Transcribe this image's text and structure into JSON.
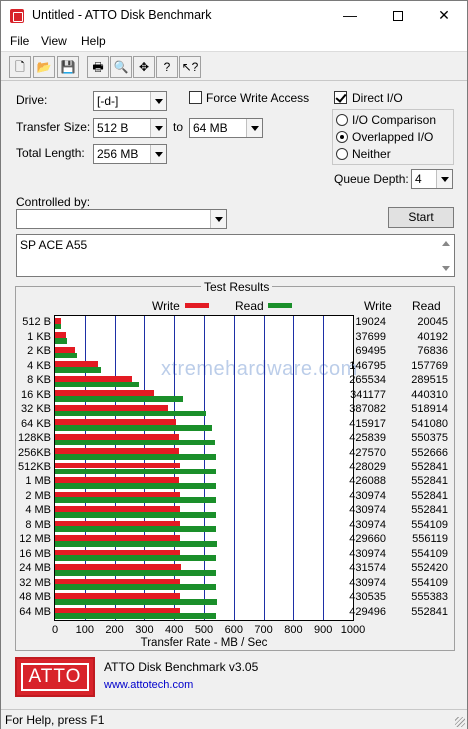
{
  "window": {
    "title": "Untitled - ATTO Disk Benchmark",
    "icon": "atto-app-icon",
    "min_glyph": "—",
    "close_glyph": "✕"
  },
  "menu": [
    "File",
    "View",
    "Help"
  ],
  "toolbar": {
    "buttons": [
      {
        "name": "new-icon",
        "glyph": "🗋"
      },
      {
        "name": "open-icon",
        "glyph": "📂"
      },
      {
        "name": "save-icon",
        "glyph": "💾"
      },
      {
        "name": "print-icon",
        "glyph": "🖶"
      },
      {
        "name": "print-preview-icon",
        "glyph": "🔍"
      },
      {
        "name": "move-icon",
        "glyph": "✥"
      },
      {
        "name": "help-icon",
        "glyph": "?"
      },
      {
        "name": "context-help-icon",
        "glyph": "↖?"
      }
    ]
  },
  "form": {
    "drive_label": "Drive:",
    "drive_value": "[-d-]",
    "transfer_size_label": "Transfer Size:",
    "transfer_from": "512 B",
    "to_label": "to",
    "transfer_to": "64 MB",
    "total_length_label": "Total Length:",
    "total_length": "256 MB",
    "force_write_label": "Force Write Access",
    "force_write_checked": false,
    "direct_io_label": "Direct I/O",
    "direct_io_checked": true,
    "io_options": [
      {
        "label": "I/O Comparison",
        "checked": false
      },
      {
        "label": "Overlapped I/O",
        "checked": true
      },
      {
        "label": "Neither",
        "checked": false
      }
    ],
    "queue_depth_label": "Queue Depth:",
    "queue_depth": "4",
    "controlled_by_label": "Controlled by:",
    "controlled_by_value": "",
    "start_label": "Start",
    "description": "SP ACE A55"
  },
  "results": {
    "title": "Test Results",
    "write_legend": "Write",
    "read_legend": "Read",
    "write_header": "Write",
    "read_header": "Read",
    "write_color": "#e31b23",
    "read_color": "#1a8f2a",
    "grid_color": "#1d2fa6",
    "watermark": "xtremehardware.com"
  },
  "chart_data": {
    "type": "bar",
    "orientation": "horizontal",
    "categories": [
      "512 B",
      "1 KB",
      "2 KB",
      "4 KB",
      "8 KB",
      "16 KB",
      "32 KB",
      "64 KB",
      "128KB",
      "256KB",
      "512KB",
      "1 MB",
      "2 MB",
      "4 MB",
      "8 MB",
      "12 MB",
      "16 MB",
      "24 MB",
      "32 MB",
      "48 MB",
      "64 MB"
    ],
    "series": [
      {
        "name": "Write",
        "values": [
          19024,
          37699,
          69495,
          146795,
          265534,
          341177,
          387082,
          415917,
          425839,
          427570,
          428029,
          426088,
          430974,
          430974,
          430974,
          429660,
          430974,
          431574,
          430974,
          430535,
          429496
        ]
      },
      {
        "name": "Read",
        "values": [
          20045,
          40192,
          76836,
          157769,
          289515,
          440310,
          518914,
          541080,
          550375,
          552666,
          552841,
          552841,
          552841,
          552841,
          554109,
          556119,
          554109,
          552420,
          554109,
          555383,
          552841
        ]
      }
    ],
    "xlabel": "Transfer Rate - MB / Sec",
    "xticks": [
      0,
      100,
      200,
      300,
      400,
      500,
      600,
      700,
      800,
      900,
      1000
    ],
    "xlim": [
      0,
      1000
    ],
    "grid": true,
    "legend": "top"
  },
  "footer": {
    "logo_text": "ATTO",
    "version": "ATTO Disk Benchmark v3.05",
    "url": "www.attotech.com",
    "url_color": "#0000cc"
  },
  "status": {
    "text": "For Help, press F1"
  }
}
